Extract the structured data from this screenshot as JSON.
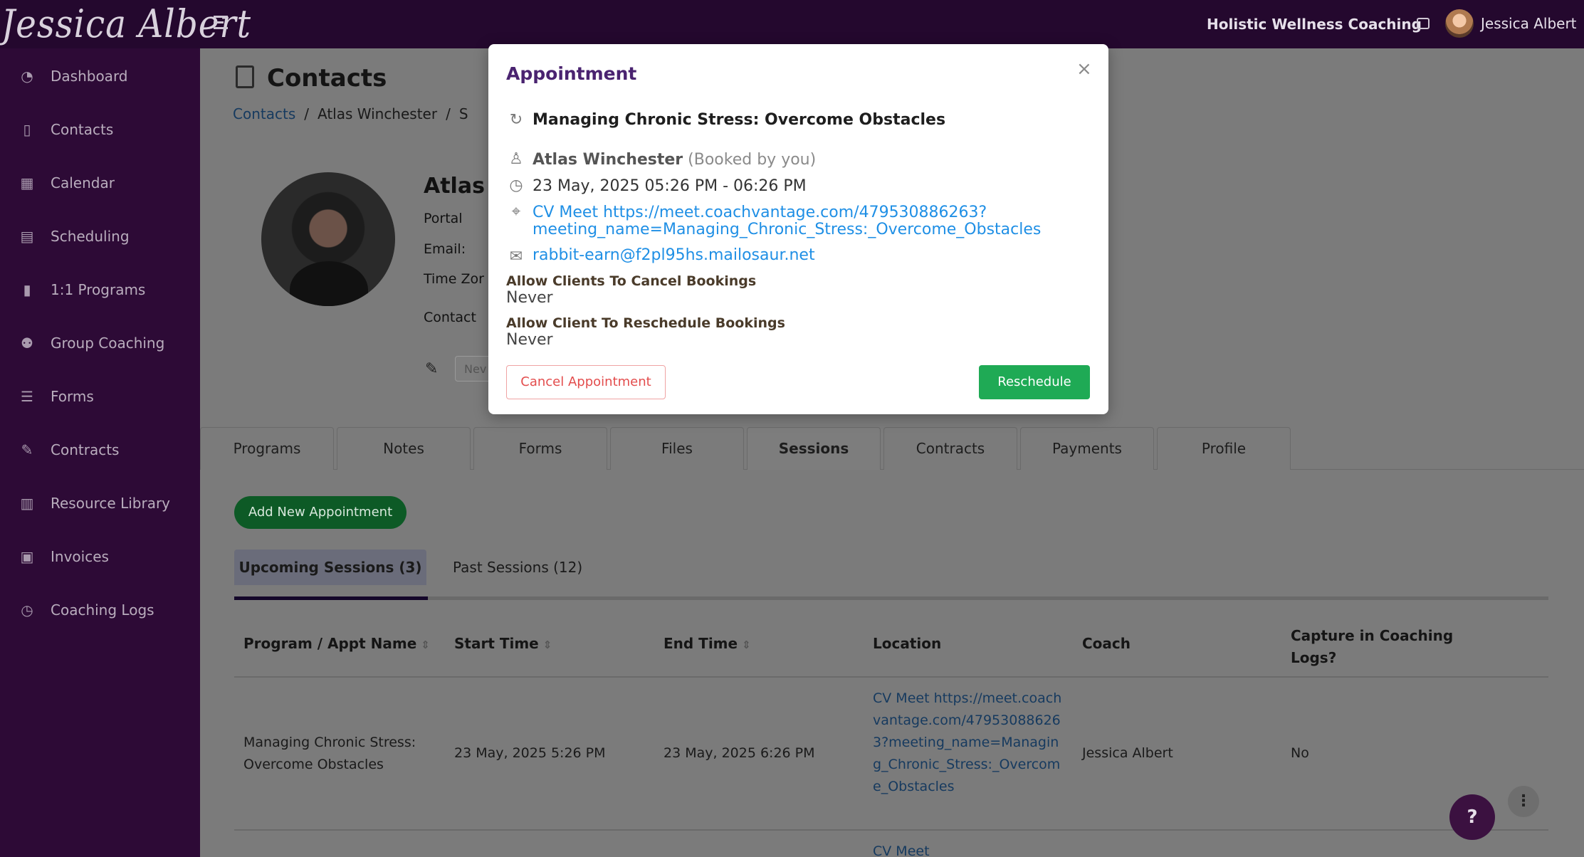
{
  "app": {
    "brand": "Jessica Albert",
    "business_name": "Holistic Wellness Coaching",
    "user_name": "Jessica Albert"
  },
  "sidebar": {
    "items": [
      {
        "label": "Dashboard",
        "icon": "dashboard-icon"
      },
      {
        "label": "Contacts",
        "icon": "contacts-icon"
      },
      {
        "label": "Calendar",
        "icon": "calendar-icon"
      },
      {
        "label": "Scheduling",
        "icon": "scheduling-icon"
      },
      {
        "label": "1:1 Programs",
        "icon": "book-icon"
      },
      {
        "label": "Group Coaching",
        "icon": "group-icon"
      },
      {
        "label": "Forms",
        "icon": "checklist-icon"
      },
      {
        "label": "Contracts",
        "icon": "contract-icon"
      },
      {
        "label": "Resource Library",
        "icon": "library-icon"
      },
      {
        "label": "Invoices",
        "icon": "invoice-icon"
      },
      {
        "label": "Coaching Logs",
        "icon": "clock-icon"
      }
    ]
  },
  "page": {
    "title": "Contacts",
    "breadcrumb": [
      "Contacts",
      "/",
      "Atlas Winchester",
      "/",
      "S"
    ]
  },
  "contact": {
    "name": "Atlas V",
    "portal_label": "Portal",
    "email_label": "Email:",
    "timezone_label": "Time Zor",
    "contact_type_label": "Contact",
    "status_chip": "Nev"
  },
  "tabs": [
    "Programs",
    "Notes",
    "Forms",
    "Files",
    "Sessions",
    "Contracts",
    "Payments",
    "Profile"
  ],
  "sessions": {
    "add_button": "Add New Appointment",
    "upcoming_tab": "Upcoming Sessions (3)",
    "past_tab": "Past Sessions (12)",
    "columns": [
      "Program / Appt Name",
      "Start Time",
      "End Time",
      "Location",
      "Coach",
      "Capture in Coaching Logs?"
    ],
    "sort_icon": "⇕",
    "rows": [
      {
        "name": "Managing Chronic Stress: Overcome Obstacles",
        "start": "23 May, 2025 5:26 PM",
        "end": "23 May, 2025 6:26 PM",
        "location": "CV Meet https://meet.coachvantage.com/479530886263?meeting_name=Managing_Chronic_Stress:_Overcome_Obstacles",
        "coach": "Jessica Albert",
        "capture": "No"
      }
    ],
    "next_row_location_preview": "CV Meet"
  },
  "modal": {
    "title": "Appointment",
    "close": "×",
    "session_title": "Managing Chronic Stress: Overcome Obstacles",
    "client_name": "Atlas Winchester",
    "booked_by": "(Booked by you)",
    "datetime": "23 May, 2025 05:26 PM - 06:26 PM",
    "location_line1": "CV Meet https://meet.coachvantage.com/479530886263?",
    "location_line2": "meeting_name=Managing_Chronic_Stress:_Overcome_Obstacles",
    "email": "rabbit-earn@f2pl95hs.mailosaur.net",
    "cancel_policy_label": "Allow Clients To Cancel Bookings",
    "cancel_policy_value": "Never",
    "reschedule_policy_label": "Allow Client To Reschedule Bookings",
    "reschedule_policy_value": "Never",
    "cancel_button": "Cancel Appointment",
    "reschedule_button": "Reschedule"
  },
  "help": {
    "label": "?"
  },
  "colors": {
    "topbar": "#24082e",
    "sidebar": "#2d0a36",
    "modal_title": "#4a2370",
    "link": "#1f8fe5",
    "reschedule": "#1faa55",
    "cancel": "#e34d4d"
  }
}
